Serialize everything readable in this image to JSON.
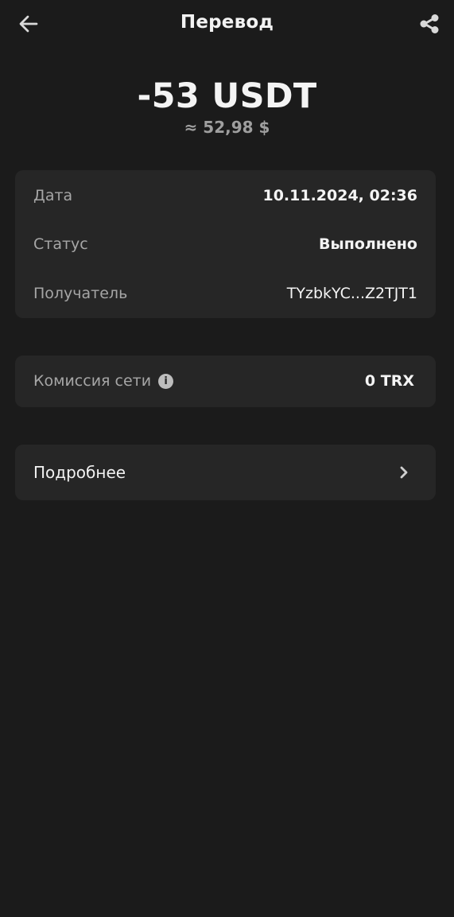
{
  "header": {
    "title": "Перевод",
    "back_icon": "arrow-left-icon",
    "share_icon": "share-icon"
  },
  "transaction": {
    "amount": "-53 USDT",
    "fiat": "≈ 52,98 $"
  },
  "details": {
    "rows": [
      {
        "label": "Дата",
        "value": "10.11.2024, 02:36"
      },
      {
        "label": "Статус",
        "value": "Выполнено"
      },
      {
        "label": "Получатель",
        "value": "TYzbkYC...Z2TJT1"
      }
    ]
  },
  "fee": {
    "label": "Комиссия сети",
    "icon": "info-icon",
    "value": "0 TRX"
  },
  "more": {
    "label": "Подробнее",
    "icon": "chevron-right-icon"
  },
  "colors": {
    "background": "#1b1b1b",
    "card": "#262626",
    "primary_text": "#f4f4f4",
    "secondary_text": "#a6a6a6"
  }
}
